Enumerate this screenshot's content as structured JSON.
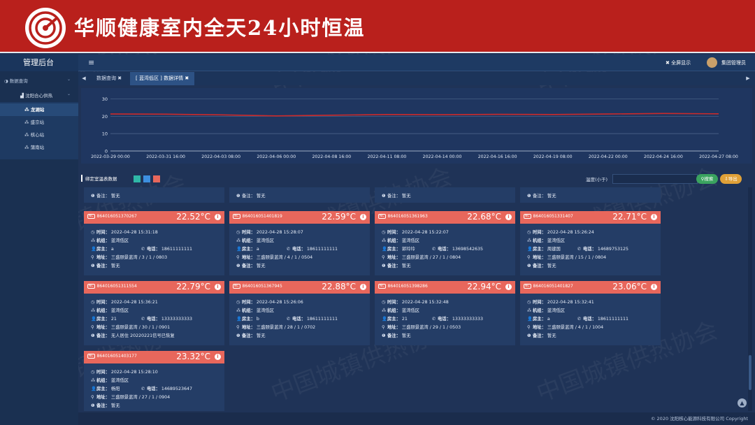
{
  "banner": {
    "title": "华顺健康室内全天24小时恒温"
  },
  "header": {
    "admin_title": "管理后台",
    "menu_icon": "≡",
    "fullscreen": "全屏显示",
    "user": "集团管理员"
  },
  "sidebar": {
    "group": "数据查询",
    "subgroup": "沈阳合心供热",
    "items": [
      {
        "label": "龙湖站",
        "active": true
      },
      {
        "label": "盛京站",
        "active": false
      },
      {
        "label": "核心站",
        "active": false
      },
      {
        "label": "蒲南站",
        "active": false
      }
    ]
  },
  "tabs": [
    {
      "label": "数据查询",
      "active": false
    },
    {
      "label": "[ 蓝湾低区 ] 数据详情",
      "active": true
    }
  ],
  "chart_data": {
    "type": "line",
    "x": [
      "2022-03-29 00:00",
      "2022-03-31 16:00",
      "2022-04-03 08:00",
      "2022-04-06 00:00",
      "2022-04-08 16:00",
      "2022-04-11 08:00",
      "2022-04-14 00:00",
      "2022-04-16 16:00",
      "2022-04-19 08:00",
      "2022-04-22 00:00",
      "2022-04-24 16:00",
      "2022-04-27 08:00"
    ],
    "series": [
      {
        "values": [
          21.3,
          21.2,
          20.8,
          20.2,
          20.6,
          21.0,
          20.9,
          21.1,
          21.0,
          21.3,
          21.6,
          21.4
        ],
        "color": "#cc2a2a"
      }
    ],
    "y_ticks": [
      "0",
      "10",
      "20",
      "30"
    ],
    "ylim": [
      0,
      33
    ],
    "grid": true
  },
  "filter": {
    "label": "绑定室温表数据",
    "swatches": [
      "#2fb7a7",
      "#3d8fe0",
      "#e8675c"
    ],
    "temp_label": "温度(小于)",
    "search": "搜索",
    "export": "导出"
  },
  "labels": {
    "time": "时间：",
    "unit": "机组：",
    "owner": "房主：",
    "phone": "电话：",
    "address": "地址：",
    "note": "备注：",
    "note_top": "备注： 暂无"
  },
  "cards": [
    {
      "id": "864016051370267",
      "temp": "22.52°C",
      "time": "2022-04-28 15:31:18",
      "unit": "蓝湾低区",
      "owner": "a",
      "phone": "18611111111",
      "address": "三盛颐景蓝湾 / 3 / 1 / 0803",
      "note": "暂无"
    },
    {
      "id": "864016051401819",
      "temp": "22.59°C",
      "time": "2022-04-28 15:28:07",
      "unit": "蓝湾低区",
      "owner": "a",
      "phone": "18611111111",
      "address": "三盛颐景蓝湾 / 4 / 1 / 0504",
      "note": "暂无"
    },
    {
      "id": "864016051361963",
      "temp": "22.68°C",
      "time": "2022-04-28 15:22:07",
      "unit": "蓝湾低区",
      "owner": "郭玲玲",
      "phone": "13698542635",
      "address": "三盛颐景蓝湾 / 27 / 1 / 0804",
      "note": "暂无"
    },
    {
      "id": "864016051331407",
      "temp": "22.71°C",
      "time": "2022-04-28 15:26:24",
      "unit": "蓝湾低区",
      "owner": "周建国",
      "phone": "14689753125",
      "address": "三盛颐景蓝湾 / 15 / 1 / 0804",
      "note": "暂无"
    },
    {
      "id": "864016051311554",
      "temp": "22.79°C",
      "time": "2022-04-28 15:36:21",
      "unit": "蓝湾低区",
      "owner": "21",
      "phone": "13333333333",
      "address": "三盛颐景蓝湾 / 30 / 1 / 0901",
      "note": "无人居住 20220221信号已恢复"
    },
    {
      "id": "864016051367945",
      "temp": "22.88°C",
      "time": "2022-04-28 15:26:06",
      "unit": "蓝湾低区",
      "owner": "b",
      "phone": "18611111111",
      "address": "三盛颐景蓝湾 / 28 / 1 / 0702",
      "note": "暂无"
    },
    {
      "id": "864016051398286",
      "temp": "22.94°C",
      "time": "2022-04-28 15:32:48",
      "unit": "蓝湾低区",
      "owner": "21",
      "phone": "13333333333",
      "address": "三盛颐景蓝湾 / 29 / 1 / 0503",
      "note": "暂无"
    },
    {
      "id": "864016051401827",
      "temp": "23.06°C",
      "time": "2022-04-28 15:32:41",
      "unit": "蓝湾低区",
      "owner": "a",
      "phone": "18611111111",
      "address": "三盛颐景蓝湾 / 4 / 1 / 1004",
      "note": "暂无"
    },
    {
      "id": "864016051403177",
      "temp": "23.32°C",
      "time": "2022-04-28 15:28:10",
      "unit": "蓝湾低区",
      "owner": "杨阳",
      "phone": "14689523647",
      "address": "三盛颐景蓝湾 / 27 / 1 / 0904",
      "note": "暂无"
    }
  ],
  "footer": {
    "text": "© 2020 沈阳核心能源科技有限公司 Copyright"
  },
  "watermark": "中国城镇供热协会"
}
